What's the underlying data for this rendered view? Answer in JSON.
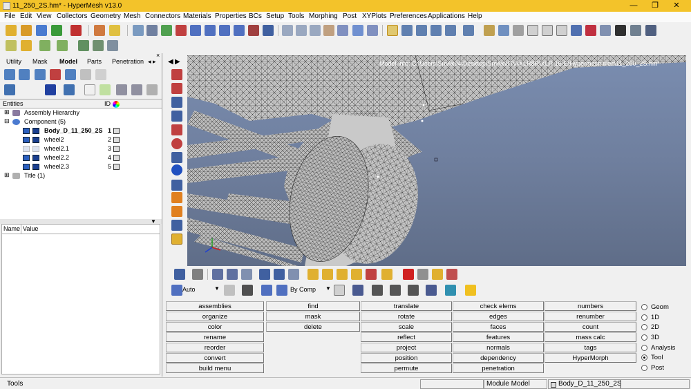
{
  "window": {
    "title": "11_250_2S.hm* - HyperMesh v13.0",
    "minimize": "—",
    "maximize": "❐",
    "close": "✕"
  },
  "menu": [
    "File",
    "Edit",
    "View",
    "Collectors",
    "Geometry",
    "Mesh",
    "Connectors",
    "Materials",
    "Properties",
    "BCs",
    "Setup",
    "Tools",
    "Morphing",
    "Post",
    "XYPlots",
    "Preferences",
    "Applications",
    "Help"
  ],
  "tabs": {
    "utility": "Utility",
    "mask": "Mask",
    "model": "Model",
    "parts": "Parts",
    "penetration": "Penetration",
    "scroll": "◂ ▸",
    "close": "×"
  },
  "browser": {
    "header_entities": "Entities",
    "header_id": "ID",
    "rows": [
      {
        "label": "Assembly Hierarchy",
        "id": "",
        "bold": false
      },
      {
        "label": "Component (5)",
        "id": "",
        "bold": false
      },
      {
        "label": "Body_D_11_250_2S",
        "id": "1",
        "bold": true
      },
      {
        "label": "wheel2",
        "id": "2",
        "bold": false
      },
      {
        "label": "wheel2.1",
        "id": "3",
        "bold": false
      },
      {
        "label": "wheel2.2",
        "id": "4",
        "bold": false
      },
      {
        "label": "wheel2.3",
        "id": "5",
        "bold": false
      },
      {
        "label": "Title (1)",
        "id": "",
        "bold": false
      }
    ],
    "props_name": "Name",
    "props_value": "Value"
  },
  "viewport": {
    "model_info": "Model Info: C:\\Users\\SmAk04\\Desktop\\SmAk\\IIT\\AXLR8R\\XLR 16-E\\Hypermesh files\\11_250_2S.hm*"
  },
  "toolbar2": {
    "auto": "Auto",
    "by_comp": "By Comp"
  },
  "panels": {
    "col1": [
      "assemblies",
      "organize",
      "color",
      "rename",
      "reorder",
      "convert",
      "build menu"
    ],
    "col2": [
      "find",
      "mask",
      "delete"
    ],
    "col3": [
      "translate",
      "rotate",
      "scale",
      "reflect",
      "project",
      "position",
      "permute"
    ],
    "col4": [
      "check elems",
      "edges",
      "faces",
      "features",
      "normals",
      "dependency",
      "penetration"
    ],
    "col5": [
      "numbers",
      "renumber",
      "count",
      "mass calc",
      "tags",
      "HyperMorph"
    ]
  },
  "radios": [
    {
      "label": "Geom",
      "on": false
    },
    {
      "label": "1D",
      "on": false
    },
    {
      "label": "2D",
      "on": false
    },
    {
      "label": "3D",
      "on": false
    },
    {
      "label": "Analysis",
      "on": false
    },
    {
      "label": "Tool",
      "on": true
    },
    {
      "label": "Post",
      "on": false
    }
  ],
  "status": {
    "left": "Tools",
    "module": "Module Model",
    "component": "Body_D_11_250_2S"
  },
  "colors": {
    "titlebar": "#f3c32a",
    "viewport_top": "#7a8db0",
    "viewport_bottom": "#5f6d88",
    "component_icon": "#2b5fbf"
  }
}
